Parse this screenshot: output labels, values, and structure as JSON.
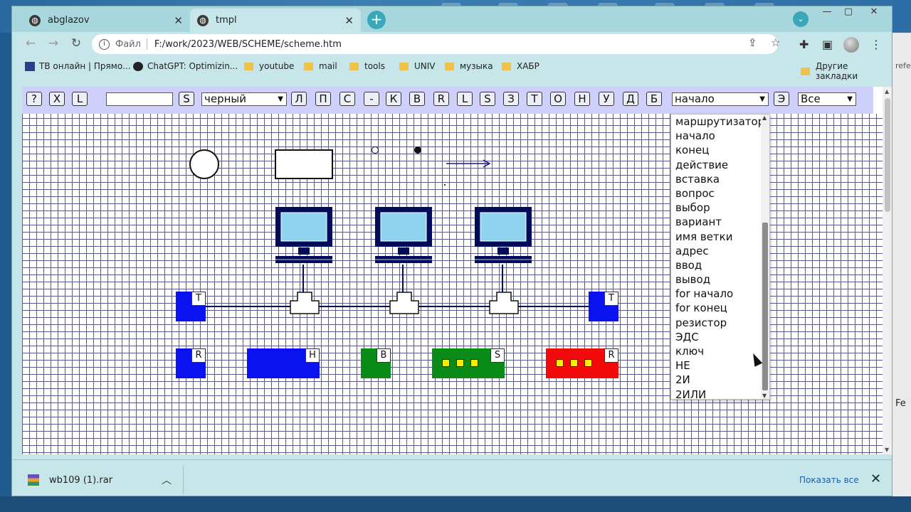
{
  "browser": {
    "tabs": [
      {
        "title": "abglazov",
        "close": "✕"
      },
      {
        "title": "tmpl",
        "close": "✕"
      }
    ],
    "new_tab": "+",
    "tab_list": "⌄",
    "window_controls": {
      "min": "—",
      "max": "▢",
      "close": "✕"
    },
    "nav": {
      "back": "←",
      "forward": "→",
      "reload": "↻"
    },
    "address": {
      "scheme_label": "Файл",
      "url": "F:/work/2023/WEB/SCHEME/scheme.htm"
    },
    "bookmarks": [
      "ТВ онлайн | Прямо...",
      "ChatGPT: Optimizin...",
      "youtube",
      "mail",
      "tools",
      "UNIV",
      "музыка",
      "ХАБР"
    ],
    "other_bookmarks": "Другие закладки"
  },
  "controls": {
    "buttons_left": [
      "?",
      "X",
      "L"
    ],
    "text_value": "",
    "s_button": "S",
    "color_select": "черный",
    "letter_buttons": [
      "Л",
      "П",
      "С",
      "-",
      "К",
      "В",
      "R",
      "L",
      "S",
      "З",
      "Т",
      "О",
      "Н",
      "У",
      "Д",
      "Б"
    ],
    "type_select": "начало",
    "e_button": "Э",
    "scope_select": "Все"
  },
  "dropdown_options": [
    "маршрутизатор",
    "начало",
    "конец",
    "действие",
    "вставка",
    "вопрос",
    "выбор",
    "вариант",
    "имя ветки",
    "адрес",
    "ввод",
    "вывод",
    "for начало",
    "for конец",
    "резистор",
    "ЭДС",
    "ключ",
    "НЕ",
    "2И",
    "2ИЛИ"
  ],
  "scheme": {
    "terminators": [
      "T",
      "T"
    ],
    "bottom_blocks": [
      "R",
      "H",
      "B",
      "S",
      "R"
    ],
    "colors": {
      "blue": "#0a12f0",
      "green": "#0a8a16",
      "red": "#f00a0a",
      "yellow": "#ffee00",
      "screen": "#8fd3ef",
      "frame": "#000c5a"
    }
  },
  "download": {
    "file": "wb109 (1).rar",
    "show_all": "Показать все",
    "close": "✕"
  },
  "desktop": {
    "right_labels": [
      "refe",
      "Fe"
    ]
  }
}
